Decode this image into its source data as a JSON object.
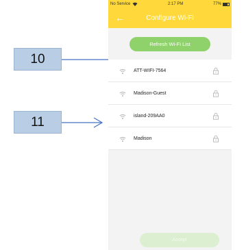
{
  "callouts": [
    {
      "label": "10"
    },
    {
      "label": "11"
    }
  ],
  "status_bar": {
    "carrier": "No Service",
    "time": "2:17 PM",
    "battery_percent": "77%",
    "battery_level": 0.77
  },
  "header": {
    "title": "Configure Wi-Fi",
    "back_icon": "back-arrow-icon"
  },
  "refresh_label": "Refresh Wi-Fi List",
  "networks": [
    {
      "ssid": "ATT-WIFI-7564",
      "locked": true
    },
    {
      "ssid": "Madison-Guest",
      "locked": true
    },
    {
      "ssid": "island-209AA0",
      "locked": true
    },
    {
      "ssid": "Madison",
      "locked": true
    }
  ],
  "accept_label": "Accept",
  "colors": {
    "header": "#ffd93b",
    "primary_button": "#8fd16a",
    "disabled_button": "#dcefd1",
    "callout_fill": "#b9cde5",
    "arrow": "#4472c4"
  }
}
